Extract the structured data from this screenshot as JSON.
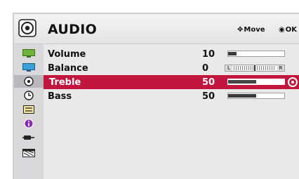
{
  "header": {
    "title": "AUDIO",
    "move_hint": "Move",
    "ok_hint": "OK",
    "icon": "speaker-icon"
  },
  "sidebar": {
    "items": [
      {
        "name": "picture",
        "icon": "monitor-icon",
        "color": "#5aa02c"
      },
      {
        "name": "audio",
        "icon": "speaker-icon",
        "active": true
      },
      {
        "name": "sound",
        "icon": "audio-disc-icon"
      },
      {
        "name": "time",
        "icon": "clock-icon"
      },
      {
        "name": "setup",
        "icon": "tools-icon"
      },
      {
        "name": "option",
        "icon": "info-icon",
        "color": "#7a1fa0"
      },
      {
        "name": "input",
        "icon": "input-plug-icon"
      },
      {
        "name": "usb",
        "icon": "media-icon"
      }
    ]
  },
  "settings": [
    {
      "label": "Volume",
      "value": "10",
      "type": "slider",
      "level": 0.15
    },
    {
      "label": "Balance",
      "value": "0",
      "type": "balance",
      "left_label": "L",
      "right_label": "R"
    },
    {
      "label": "Treble",
      "value": "50",
      "type": "slider",
      "level": 0.5,
      "selected": true
    },
    {
      "label": "Bass",
      "value": "50",
      "type": "slider",
      "level": 0.5
    }
  ],
  "colors": {
    "highlight": "#c2163f",
    "panel": "#e9e9ea"
  }
}
